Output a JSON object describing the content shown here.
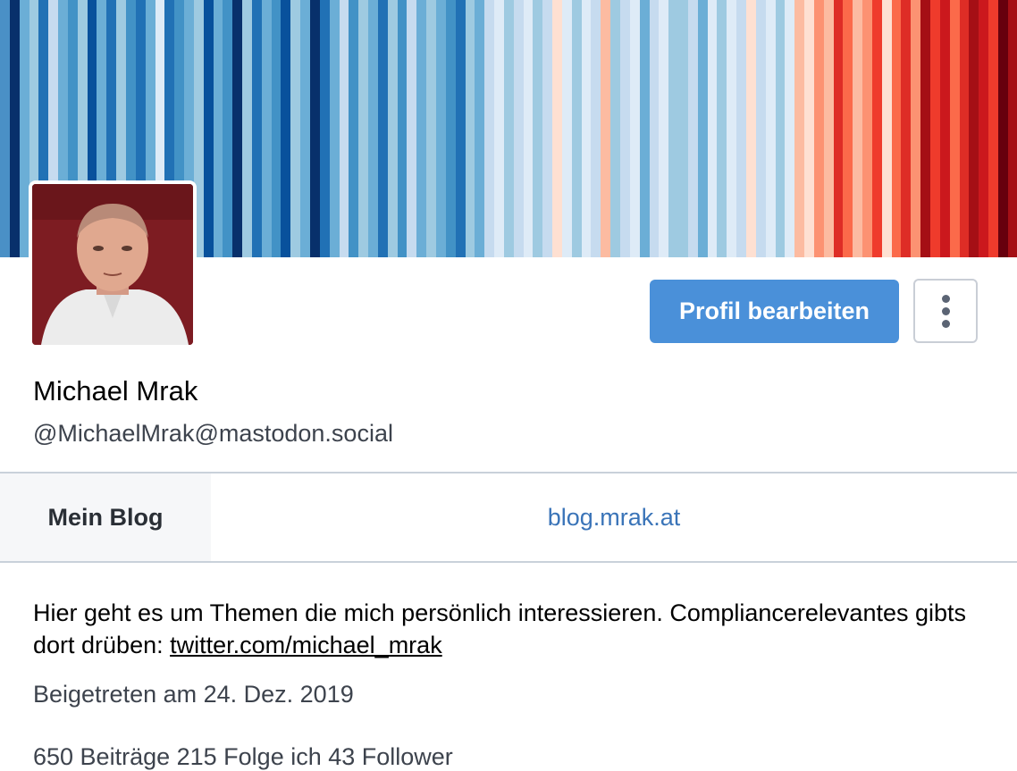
{
  "banner": {
    "stripe_colors": [
      "#4a90c6",
      "#08306b",
      "#6baed6",
      "#9ecae1",
      "#2171b5",
      "#c6dbef",
      "#6baed6",
      "#4292c6",
      "#9ecae1",
      "#08519c",
      "#6baed6",
      "#2171b5",
      "#9ecae1",
      "#4292c6",
      "#2171b5",
      "#6baed6",
      "#deebf7",
      "#2171b5",
      "#4292c6",
      "#6baed6",
      "#9ecae1",
      "#08519c",
      "#6baed6",
      "#4292c6",
      "#08306b",
      "#9ecae1",
      "#2171b5",
      "#6baed6",
      "#4292c6",
      "#08519c",
      "#9ecae1",
      "#6baed6",
      "#08306b",
      "#2171b5",
      "#6baed6",
      "#c6dbef",
      "#4292c6",
      "#9ecae1",
      "#6baed6",
      "#2171b5",
      "#9ecae1",
      "#4292c6",
      "#c6dbef",
      "#6baed6",
      "#9ecae1",
      "#6baed6",
      "#4292c6",
      "#2171b5",
      "#9ecae1",
      "#6baed6",
      "#c6dbef",
      "#deebf7",
      "#9ecae1",
      "#c6dbef",
      "#deebf7",
      "#9ecae1",
      "#c6dbef",
      "#fee0d2",
      "#deebf7",
      "#9ecae1",
      "#deebf7",
      "#c6dbef",
      "#fcbba1",
      "#9ecae1",
      "#c6dbef",
      "#deebf7",
      "#6baed6",
      "#c6dbef",
      "#deebf7",
      "#9ecae1",
      "#9ecae1",
      "#c6dbef",
      "#6baed6",
      "#deebf7",
      "#9ecae1",
      "#deebf7",
      "#c6dbef",
      "#fee0d2",
      "#c6dbef",
      "#deebf7",
      "#9ecae1",
      "#deebf7",
      "#fcbba1",
      "#fee0d2",
      "#fc9272",
      "#fcbba1",
      "#de2d26",
      "#fb6a4a",
      "#fcbba1",
      "#fc9272",
      "#ef3b2c",
      "#fee0d2",
      "#fb6a4a",
      "#de2d26",
      "#fc9272",
      "#a50f15",
      "#ef3b2c",
      "#cb181d",
      "#fb6a4a",
      "#de2d26",
      "#a50f15",
      "#cb181d",
      "#ef3b2c",
      "#67000d",
      "#a50f15"
    ]
  },
  "avatar": {
    "alt": "Michael Mrak avatar"
  },
  "actions": {
    "edit_label": "Profil bearbeiten"
  },
  "profile": {
    "display_name": "Michael Mrak",
    "handle": "@MichaelMrak@mastodon.social"
  },
  "field": {
    "label": "Mein Blog",
    "value": "blog.mrak.at"
  },
  "bio": {
    "text": "Hier geht es um Themen die mich persönlich interessieren. Compliancerelevantes gibts dort drüben: ",
    "link_text": "twitter.com/michael_mrak"
  },
  "joined": "Beigetreten am 24. Dez. 2019",
  "counts": "650 Beiträge    215 Folge ich    43 Follower"
}
